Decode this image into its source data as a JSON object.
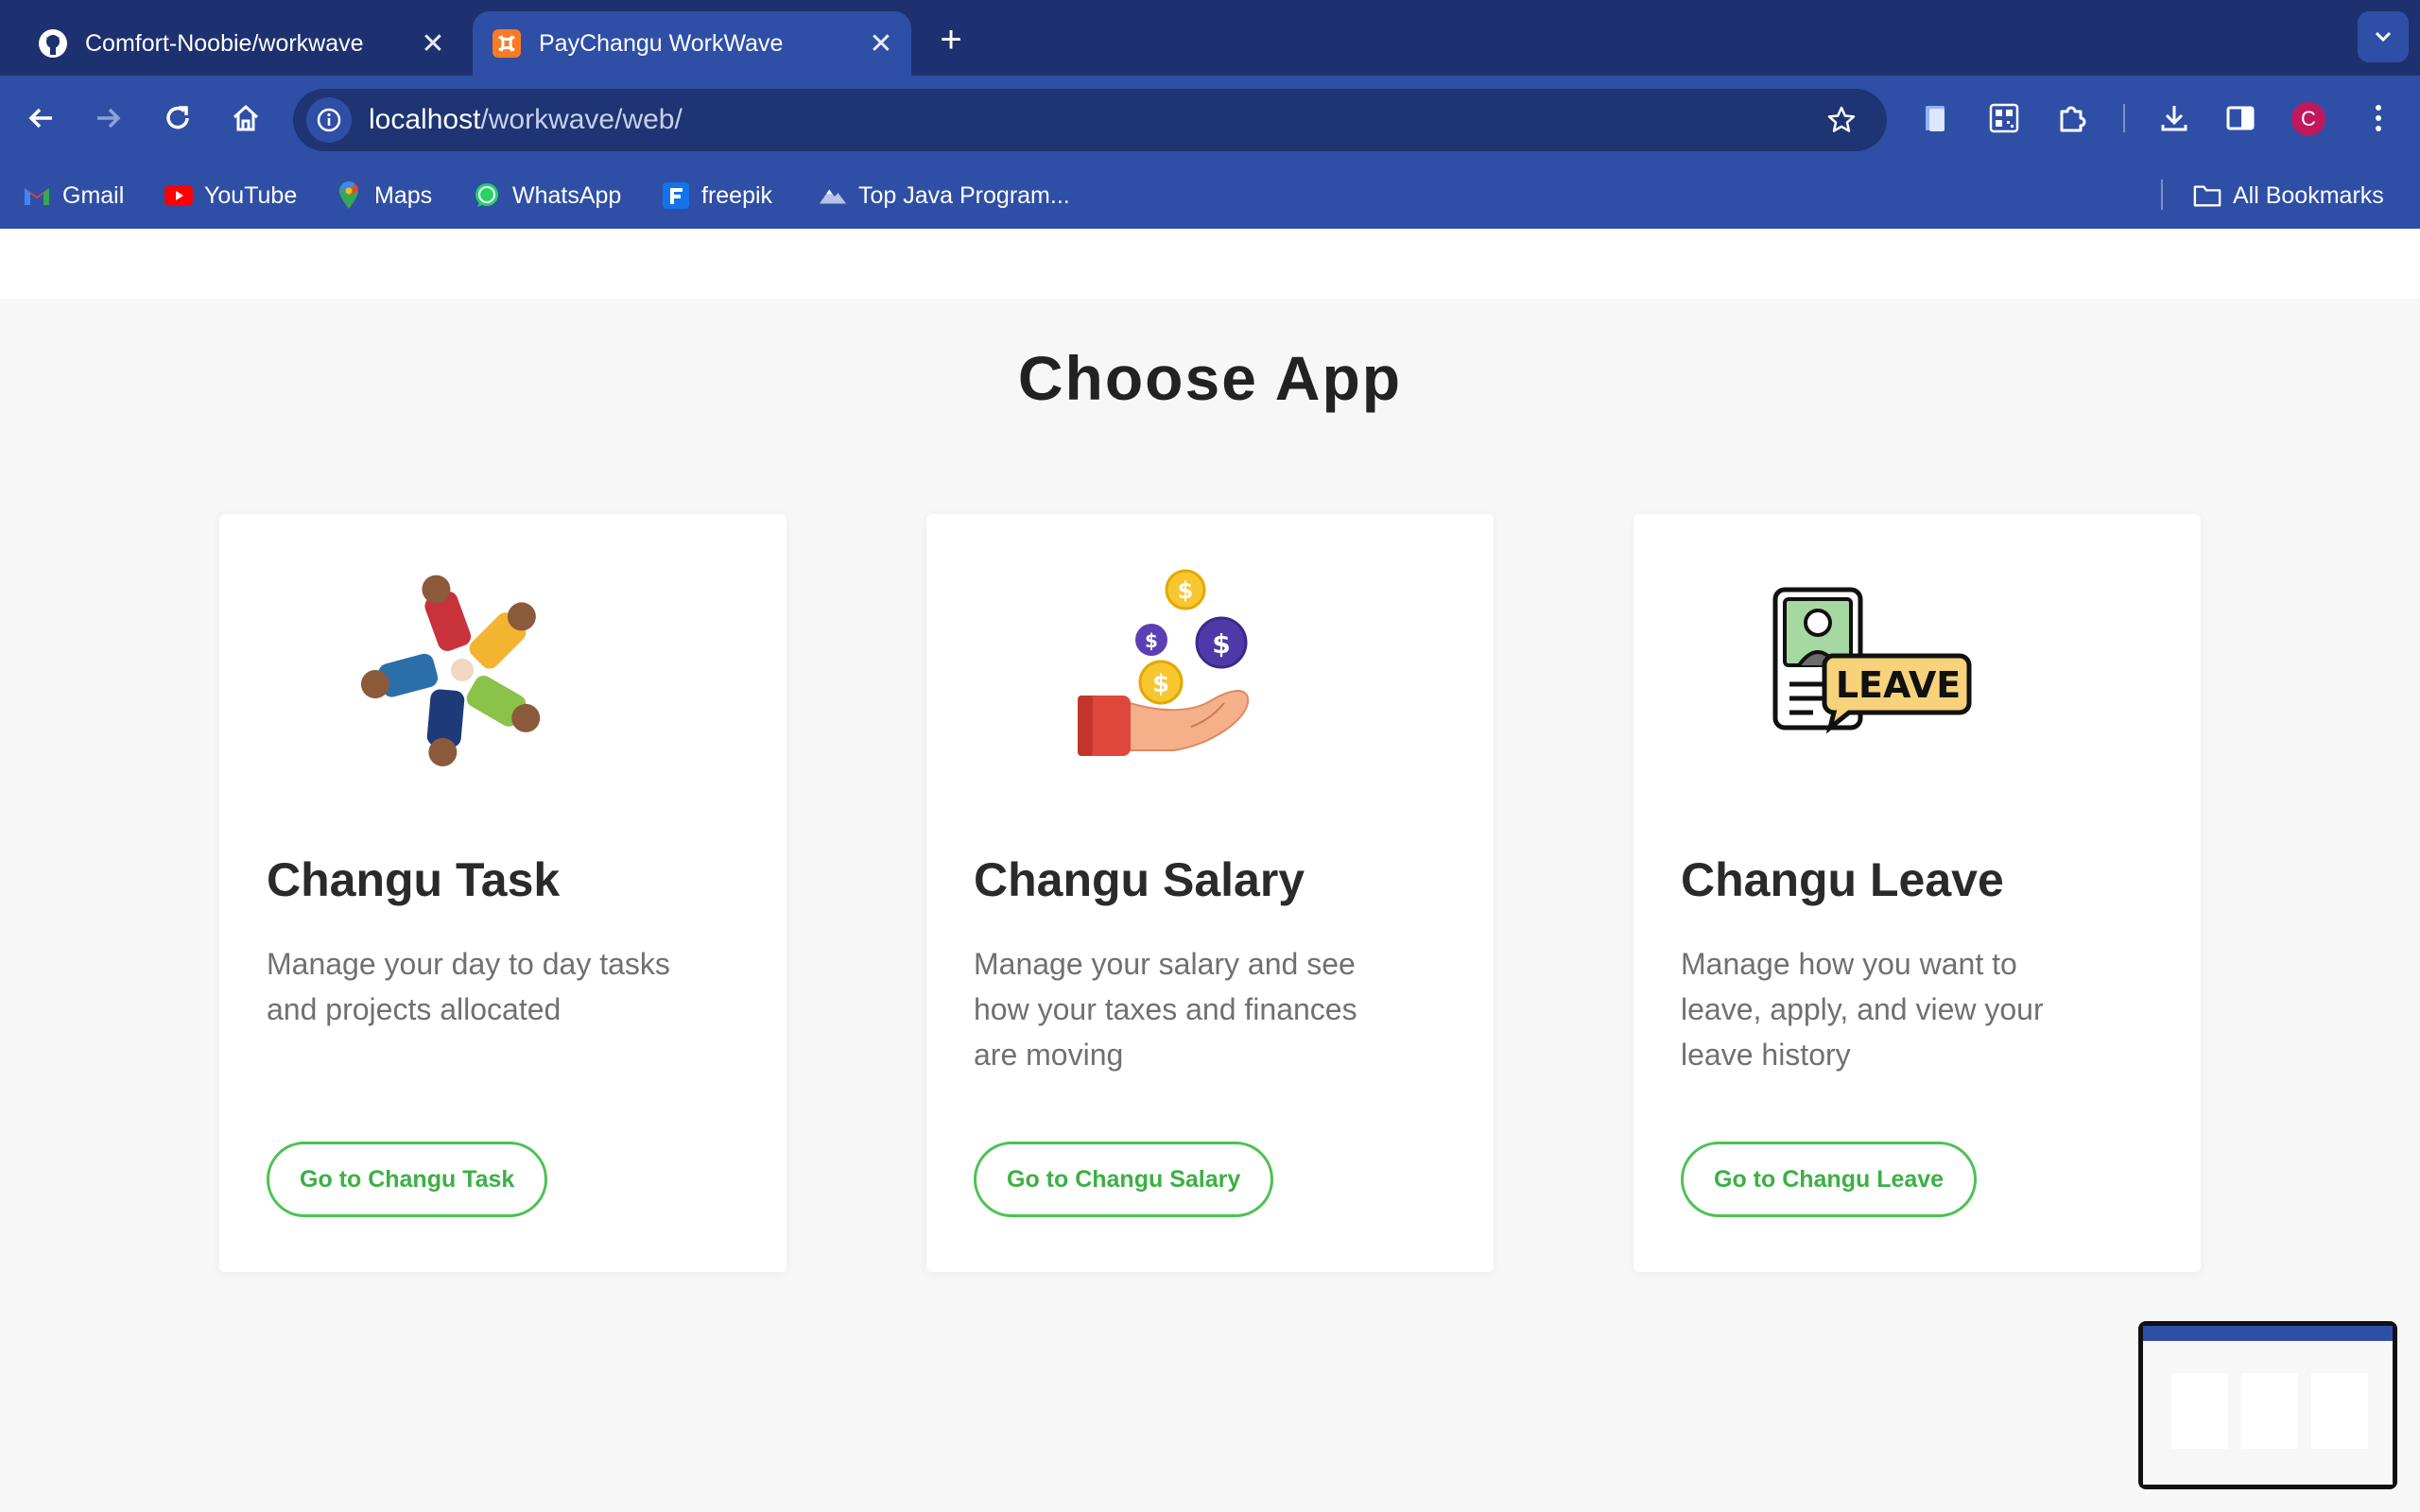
{
  "browser": {
    "tabs": [
      {
        "title": "Comfort-Noobie/workwave",
        "favicon": "github-icon",
        "active": false
      },
      {
        "title": "PayChangu WorkWave",
        "favicon": "xampp-icon",
        "active": true
      }
    ],
    "url_host": "localhost",
    "url_path": "/workwave/web/",
    "profile_initial": "C",
    "bookmarks": [
      {
        "label": "Gmail",
        "icon": "gmail-icon"
      },
      {
        "label": "YouTube",
        "icon": "youtube-icon"
      },
      {
        "label": "Maps",
        "icon": "maps-icon"
      },
      {
        "label": "WhatsApp",
        "icon": "whatsapp-icon"
      },
      {
        "label": "freepik",
        "icon": "freepik-icon"
      },
      {
        "label": "Top Java Program...",
        "icon": "mountain-icon"
      }
    ],
    "all_bookmarks_label": "All Bookmarks"
  },
  "page": {
    "title": "Choose App",
    "apps": [
      {
        "name": "Changu Task",
        "description": "Manage your day to day tasks and projects allocated",
        "button": "Go to Changu Task",
        "icon": "team-icon"
      },
      {
        "name": "Changu Salary",
        "description": "Manage your salary and see how your taxes and finances are moving",
        "button": "Go to Changu Salary",
        "icon": "salary-icon"
      },
      {
        "name": "Changu Leave",
        "description": "Manage how you want to leave, apply, and view your leave history",
        "button": "Go to Changu Leave",
        "icon": "leave-icon",
        "icon_text": "LEAVE"
      }
    ]
  },
  "colors": {
    "chrome_dark": "#1d3170",
    "chrome": "#2f4fa6",
    "accent_green": "#4cc253"
  }
}
